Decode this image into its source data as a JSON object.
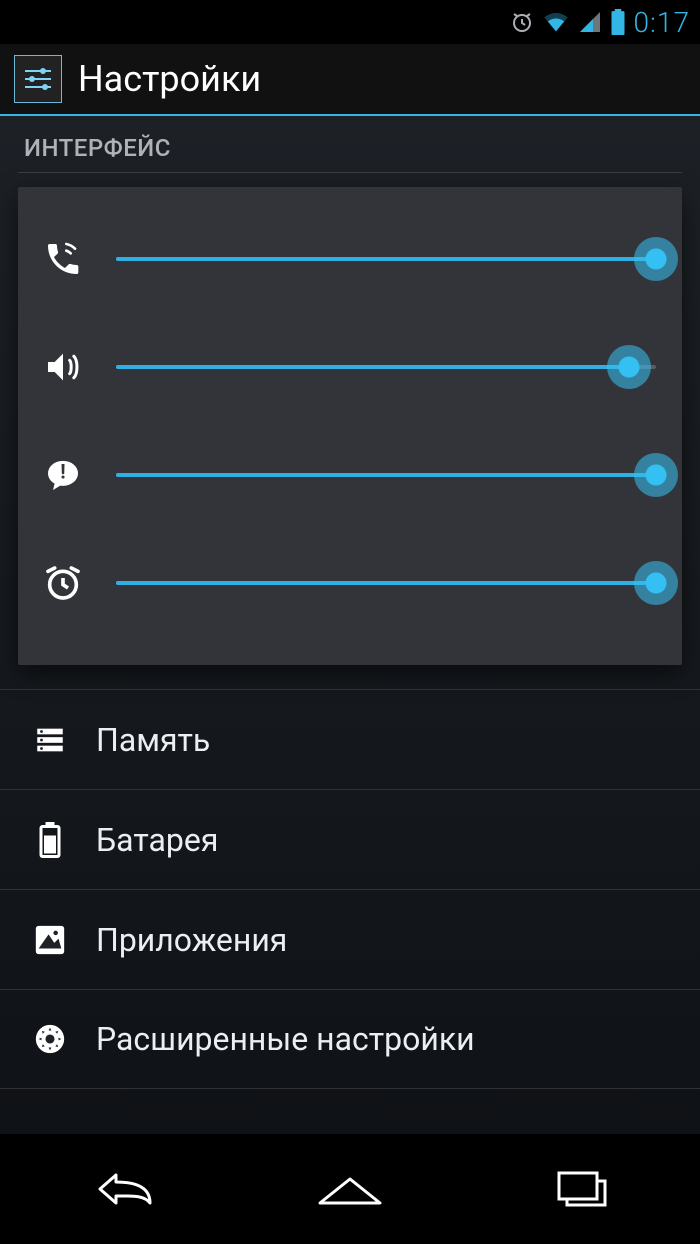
{
  "status": {
    "time": "0:17"
  },
  "header": {
    "title": "Настройки"
  },
  "section": {
    "interface": "ИНТЕРФЕЙС"
  },
  "volume": {
    "ringer": {
      "value": 100
    },
    "media": {
      "value": 95
    },
    "notification": {
      "value": 100
    },
    "alarm": {
      "value": 100
    }
  },
  "rows": {
    "storage": {
      "label": "Память"
    },
    "battery": {
      "label": "Батарея"
    },
    "apps": {
      "label": "Приложения"
    },
    "advanced": {
      "label": "Расширенные настройки"
    }
  },
  "colors": {
    "accent": "#33b5e5"
  }
}
